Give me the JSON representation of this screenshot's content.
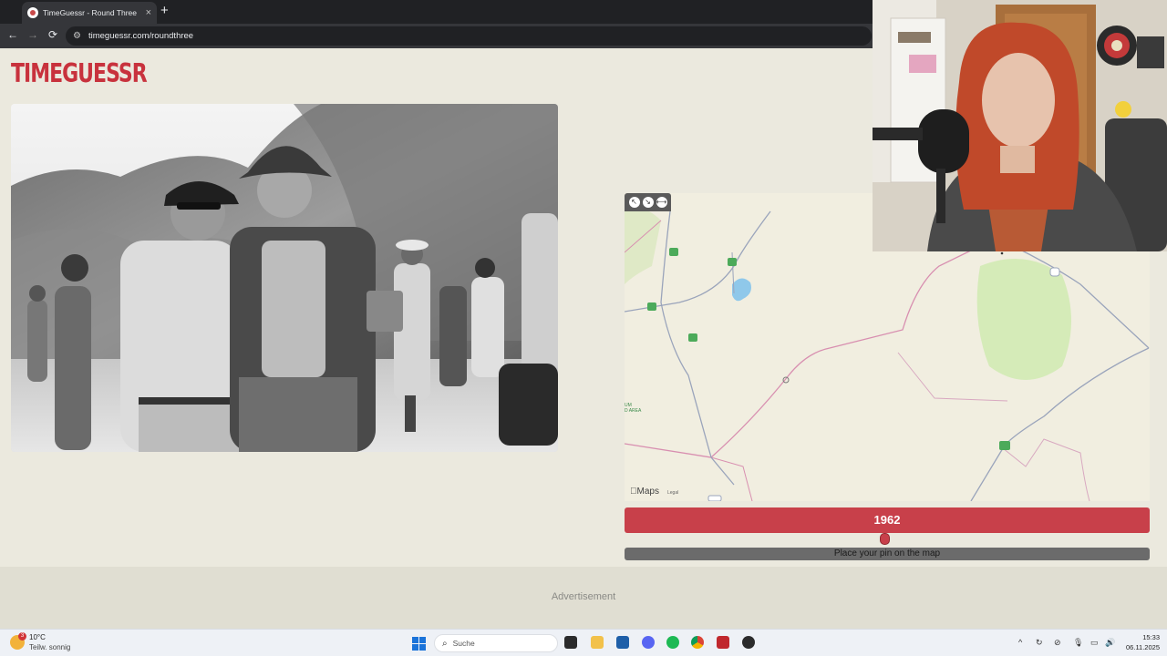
{
  "browser": {
    "tab_title": "TimeGuessr - Round Three",
    "tab_close": "×",
    "new_tab": "+",
    "url": "timeguessr.com/roundthree",
    "back": "←",
    "forward": "→",
    "reload": "⟳"
  },
  "page": {
    "logo_text": "TIMEGUESSR",
    "year": "1962",
    "pin_prompt": "Place your pin on the map",
    "advertisement": "Advertisement"
  },
  "map": {
    "brand": "Maps",
    "legal": "Legal",
    "area_label": "UM\nD AREA",
    "route_labels": [
      "15",
      "15",
      "15",
      "15",
      "35",
      "30",
      "50"
    ],
    "controls": [
      "↖",
      "↘",
      "⟷"
    ]
  },
  "taskbar": {
    "weather_temp": "10°C",
    "weather_desc": "Teilw. sonnig",
    "weather_badge": "3",
    "search_placeholder": "Suche",
    "time": "15:33",
    "date": "06.11.2025"
  },
  "colors": {
    "accent": "#c8404a",
    "page_bg": "#ebe9de",
    "map_bg": "#f1eee0",
    "border_line": "#d88fb0"
  }
}
